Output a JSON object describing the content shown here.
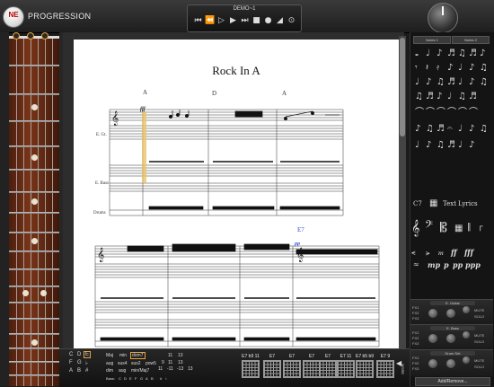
{
  "app": {
    "logo_text": "NE",
    "title": "PROGRESSION"
  },
  "transport": {
    "song_name": "DEMO~1",
    "buttons": [
      "◀◀",
      "◀◀",
      "▶",
      "▶",
      "▶",
      "■",
      "●",
      "▲",
      "⊙"
    ]
  },
  "score": {
    "title": "Rock In A",
    "chord_markers": [
      "A",
      "D",
      "A",
      "E7"
    ],
    "track_labels": [
      "E. Gt.",
      "E. Bass",
      "Drums"
    ],
    "dynamic": "fff",
    "dynamic2": "pp"
  },
  "right_panel": {
    "tabs": [
      "Notes 1",
      "Notes 2"
    ],
    "text_tools": {
      "chord": "C7",
      "text": "Text",
      "lyrics": "Lyrics"
    },
    "dynamics_row1": [
      "ff",
      "fff"
    ],
    "dynamics_row2": [
      "mp",
      "p",
      "pp",
      "ppp"
    ],
    "tracks": [
      {
        "name": "E. Guitar",
        "fx": [
          "FX1",
          "FX2",
          "FX3"
        ],
        "mute": "MUTE",
        "solo": "SOLO"
      },
      {
        "name": "E. Bass",
        "fx": [
          "FX1",
          "FX2",
          "FX3"
        ],
        "mute": "MUTE",
        "solo": "SOLO"
      },
      {
        "name": "Drum Set",
        "fx": [
          "FX1",
          "FX2",
          "FX3"
        ],
        "mute": "MUTE",
        "solo": "SOLO"
      }
    ],
    "add_remove": "Add/Remove..."
  },
  "chord_bar": {
    "roots_row1": [
      "C",
      "D",
      "E"
    ],
    "roots_row2": [
      "F",
      "G",
      "♭"
    ],
    "roots_row3": [
      "A",
      "B",
      "#"
    ],
    "types_row1": [
      "Maj",
      "min",
      "dom7"
    ],
    "types_row2": [
      "aug",
      "sus4",
      "sus2",
      "pow5"
    ],
    "types_row3": [
      "dim",
      "aug",
      "min/Maj7"
    ],
    "ext_row1": [
      "11",
      "13"
    ],
    "ext_row2": [
      "9",
      "11",
      "13"
    ],
    "ext_row3": [
      "11",
      "-11",
      "-13",
      "13"
    ],
    "bass_label": "Bass:",
    "bass_notes": [
      "C",
      "D",
      "E",
      "F",
      "G",
      "A",
      "B",
      "#",
      "♭"
    ],
    "slots": [
      "E7 b9 11",
      "E7",
      "E7",
      "E7",
      "E7",
      "E7 11",
      "E7 b5 b9",
      "E7 9"
    ],
    "more": "MORE"
  }
}
